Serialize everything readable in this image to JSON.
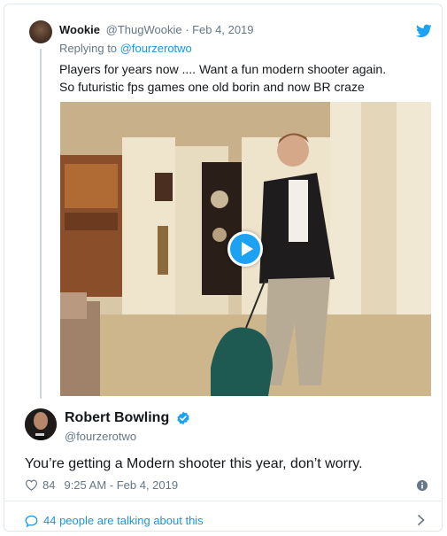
{
  "reply_tweet": {
    "author_name": "Wookie",
    "author_meta": "@ThugWookie · Feb 4, 2019",
    "replying_prefix": "Replying to ",
    "replying_to": "@fourzerotwo",
    "text_line1": "Players for years now .... Want a fun modern shooter again.",
    "text_line2": "So futuristic fps games one old borin and now BR craze"
  },
  "media": {
    "type": "gif",
    "icon": "play-icon"
  },
  "main_tweet": {
    "author_name": "Robert Bowling",
    "author_handle": "@fourzerotwo",
    "text": "You’re getting a Modern shooter this year, don’t worry.",
    "like_count": "84",
    "timestamp": "9:25 AM - Feb 4, 2019"
  },
  "footer": {
    "talking_text": "44 people are talking about this"
  },
  "colors": {
    "accent": "#1da1f2",
    "link": "#1b95e0",
    "muted": "#657786"
  }
}
